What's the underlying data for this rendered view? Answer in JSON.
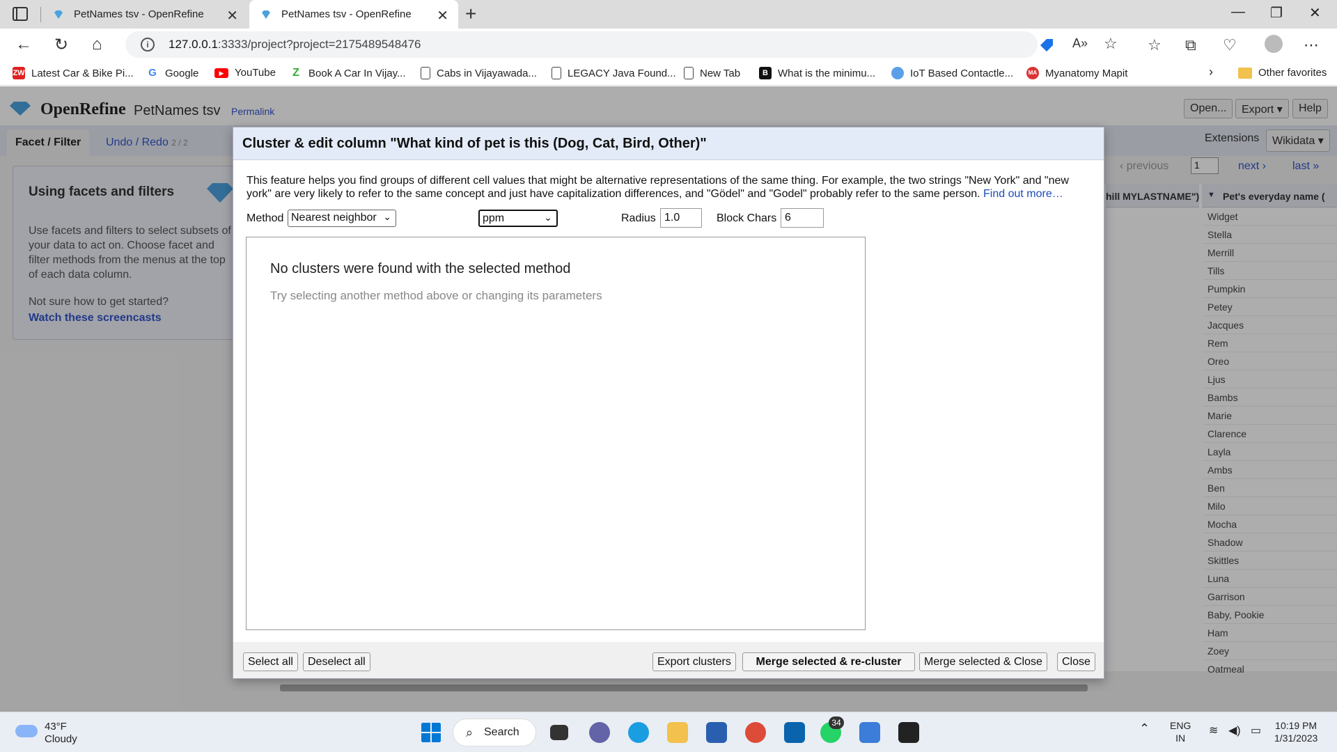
{
  "browser": {
    "tabs": [
      {
        "title": "PetNames tsv - OpenRefine",
        "active": false
      },
      {
        "title": "PetNames tsv - OpenRefine",
        "active": true
      }
    ],
    "url_host": "127.0.0.1",
    "url_rest": ":3333/project?project=2175489548476",
    "bookmarks": [
      {
        "label": "Latest Car & Bike Pi...",
        "icon": "zw-icon"
      },
      {
        "label": "Google",
        "icon": "google-icon"
      },
      {
        "label": "YouTube",
        "icon": "youtube-icon"
      },
      {
        "label": "Book A Car In Vijay...",
        "icon": "zoomcar-icon"
      },
      {
        "label": "Cabs in Vijayawada...",
        "icon": "page-icon"
      },
      {
        "label": "LEGACY Java Found...",
        "icon": "page-icon"
      },
      {
        "label": "New Tab",
        "icon": "page-icon"
      },
      {
        "label": "What is the minimu...",
        "icon": "b-icon"
      },
      {
        "label": "IoT Based Contactle...",
        "icon": "globe-icon"
      },
      {
        "label": "Myanatomy Mapit",
        "icon": "ma-icon"
      }
    ],
    "other_favorites": "Other favorites"
  },
  "openrefine": {
    "app_name": "OpenRefine",
    "project_name": "PetNames tsv",
    "permalink": "Permalink",
    "buttons": {
      "open": "Open...",
      "export": "Export ▾",
      "help": "Help"
    },
    "tabs": {
      "facet": "Facet / Filter",
      "undo": "Undo / Redo",
      "undo_count": "2 / 2"
    },
    "left_panel": {
      "title": "Using facets and filters",
      "text": "Use facets and filters to select subsets of your data to act on. Choose facet and filter methods from the menus at the top of each data column.",
      "help": "Not sure how to get started?",
      "link": "Watch these screencasts"
    },
    "extensions": "Extensions",
    "wikidata": "Wikidata ▾",
    "pager": {
      "previous": "‹ previous",
      "page": "1",
      "next": "next ›",
      "last": "last »"
    },
    "columns": [
      "hill MYLASTNAME\")",
      "Pet's everyday name ("
    ],
    "pet_names": [
      "Widget",
      "Stella",
      "Merrill",
      "Tills",
      "Pumpkin",
      "Petey",
      "Jacques",
      "Rem",
      "Oreo",
      "Ljus",
      "Bambs",
      "Marie",
      "Clarence",
      "Layla",
      "Ambs",
      "Ben",
      "Milo",
      "Mocha",
      "Shadow",
      "Skittles",
      "Luna",
      "Garrison",
      "Baby, Pookie",
      "Ham",
      "Zoey",
      "Oatmeal"
    ]
  },
  "dialog": {
    "title": "Cluster & edit column \"What kind of pet is this (Dog, Cat, Bird, Other)\"",
    "description": "This feature helps you find groups of different cell values that might be alternative representations of the same thing. For example, the two strings \"New York\" and \"new york\" are very likely to refer to the same concept and just have capitalization differences, and \"Gödel\" and \"Godel\" probably refer to the same person. ",
    "find_out_more": "Find out more…",
    "method_label": "Method",
    "method_value": "Nearest neighbor",
    "function_value": "ppm",
    "radius_label": "Radius",
    "radius_value": "1.0",
    "block_label": "Block Chars",
    "block_value": "6",
    "no_clusters": "No clusters were found with the selected method",
    "no_clusters_hint": "Try selecting another method above or changing its parameters",
    "buttons": {
      "select_all": "Select all",
      "deselect_all": "Deselect all",
      "export": "Export clusters",
      "merge_recluster": "Merge selected & re-cluster",
      "merge_close": "Merge selected & Close",
      "close": "Close"
    }
  },
  "taskbar": {
    "temp": "43°F",
    "condition": "Cloudy",
    "search": "Search",
    "whatsapp_badge": "34",
    "lang1": "ENG",
    "lang2": "IN",
    "time": "10:19 PM",
    "date": "1/31/2023"
  }
}
